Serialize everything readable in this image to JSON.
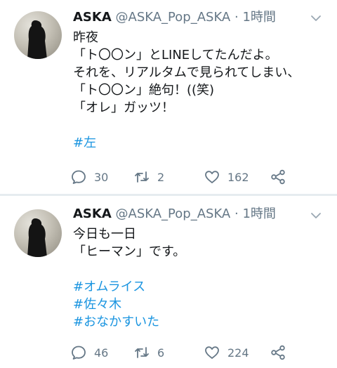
{
  "tweets": [
    {
      "name": "ASKA",
      "handle": "@ASKA_Pop_ASKA",
      "separator": "·",
      "time": "1時間",
      "lines": [
        "昨夜",
        "「ト〇〇ン」とLINEしてたんだよ。",
        "それを、リアルタムで見られてしまい、",
        "「ト〇〇ン」絶句！((笑)",
        "「オレ」ガッツ！",
        ""
      ],
      "hashtags": [
        "#左"
      ],
      "reply_count": "30",
      "retweet_count": "2",
      "like_count": "162"
    },
    {
      "name": "ASKA",
      "handle": "@ASKA_Pop_ASKA",
      "separator": "·",
      "time": "1時間",
      "lines": [
        "今日も一日",
        "「ヒーマン」です。",
        ""
      ],
      "hashtags": [
        "#オムライス",
        "#佐々木",
        "#おなかすいた"
      ],
      "reply_count": "46",
      "retweet_count": "6",
      "like_count": "224"
    }
  ],
  "icons": {
    "reply": "reply-icon",
    "retweet": "retweet-icon",
    "like": "heart-icon",
    "share": "share-icon",
    "menu": "chevron-down-icon"
  },
  "colors": {
    "text": "#14171a",
    "secondary": "#657786",
    "hashtag": "#1b95e0",
    "separator": "#e6ecf0"
  }
}
